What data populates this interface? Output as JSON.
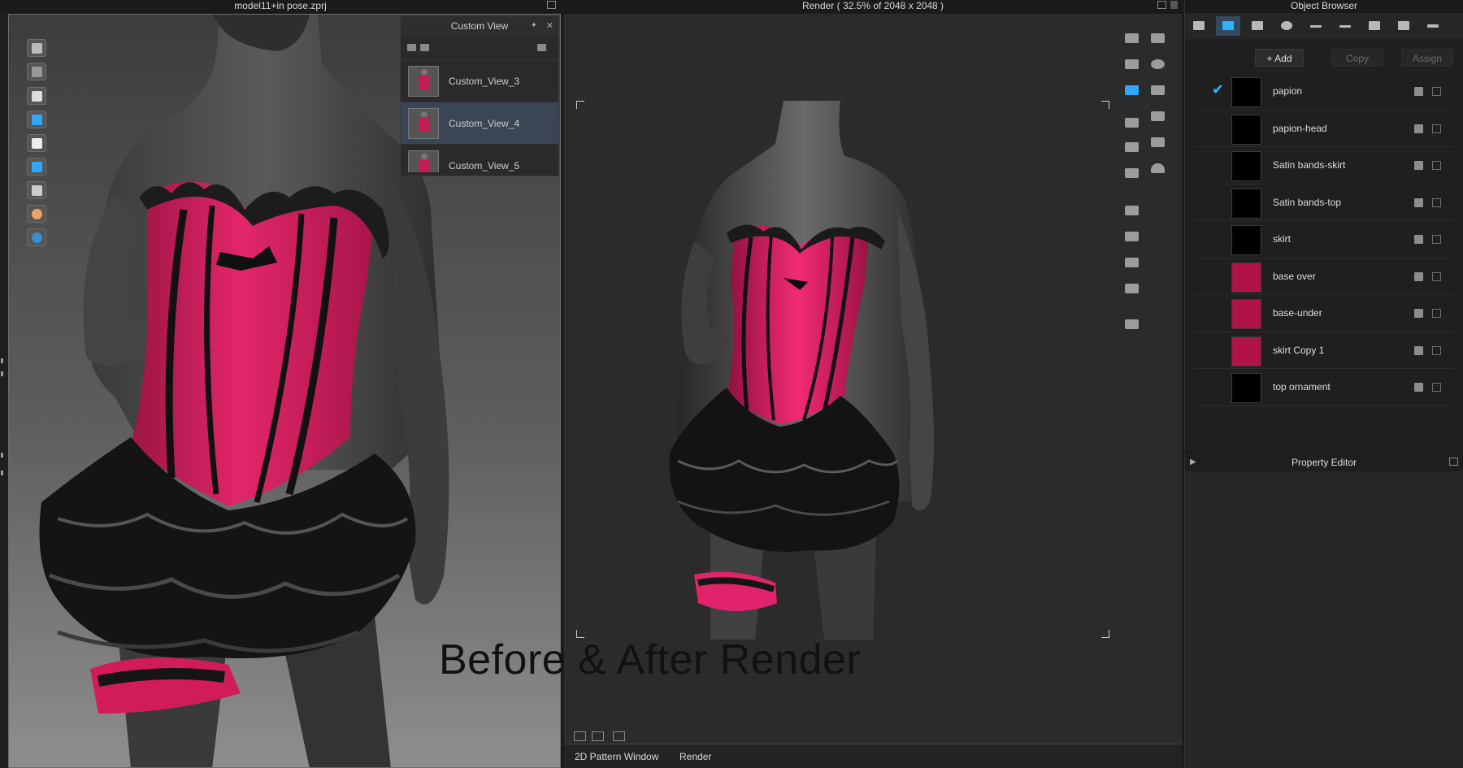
{
  "left_window": {
    "title": "model11+in pose.zprj"
  },
  "custom_view": {
    "title": "Custom View",
    "items": [
      {
        "label": "Custom_View_3",
        "active": false
      },
      {
        "label": "Custom_View_4",
        "active": true
      },
      {
        "label": "Custom_View_5",
        "active": false
      }
    ]
  },
  "render_window": {
    "title": "Render ( 32.5% of 2048 x 2048 )"
  },
  "overlay_caption": "Before & After Render",
  "bottom_tabs": [
    "2D Pattern Window",
    "Render"
  ],
  "object_browser": {
    "title": "Object Browser",
    "actions": {
      "add": "+ Add",
      "copy": "Copy",
      "assign": "Assign"
    },
    "materials": [
      {
        "name": "papion",
        "color": "#000000",
        "checked": true
      },
      {
        "name": "papion-head",
        "color": "#000000",
        "checked": false
      },
      {
        "name": "Satin bands-skirt",
        "color": "#000000",
        "checked": false
      },
      {
        "name": "Satin bands-top",
        "color": "#000000",
        "checked": false
      },
      {
        "name": "skirt",
        "color": "#000000",
        "checked": false
      },
      {
        "name": "base over",
        "color": "#b0124a",
        "checked": false
      },
      {
        "name": "base-under",
        "color": "#b0124a",
        "checked": false
      },
      {
        "name": "skirt Copy 1",
        "color": "#b0124a",
        "checked": false
      },
      {
        "name": "top ornament",
        "color": "#000000",
        "checked": false
      }
    ]
  },
  "property_editor": {
    "title": "Property Editor"
  },
  "colors": {
    "accent": "#2fb4ff",
    "garment_pink": "#d21c5a",
    "selection": "#3a4556"
  },
  "icons": {
    "left_toolbar": [
      "avatar-tool-icon",
      "garment-tool-icon",
      "shirt-icon",
      "fabric-icon",
      "avatar-show-icon",
      "solid-view-icon",
      "texture-view-icon",
      "skin-icon",
      "globe-icon"
    ],
    "render_toolbar": [
      "render-refresh-icon",
      "render-play-icon",
      "render-clapper-icon",
      "render-save-icon",
      "camera-icon",
      "image-icon",
      "image-settings-icon",
      "camera-settings-icon",
      "light-settings-icon",
      "render-settings-icon",
      "turntable-icon",
      "download-icon",
      "environment-icon",
      "brush-icon",
      "cone-icon",
      "plane-icon",
      "dome-icon"
    ],
    "object_browser_tabs": [
      "list-icon",
      "fabric-icon",
      "pattern-icon",
      "button-icon",
      "topstitch-icon",
      "line-icon",
      "zipper-icon",
      "graphic-icon",
      "trim-icon"
    ]
  }
}
